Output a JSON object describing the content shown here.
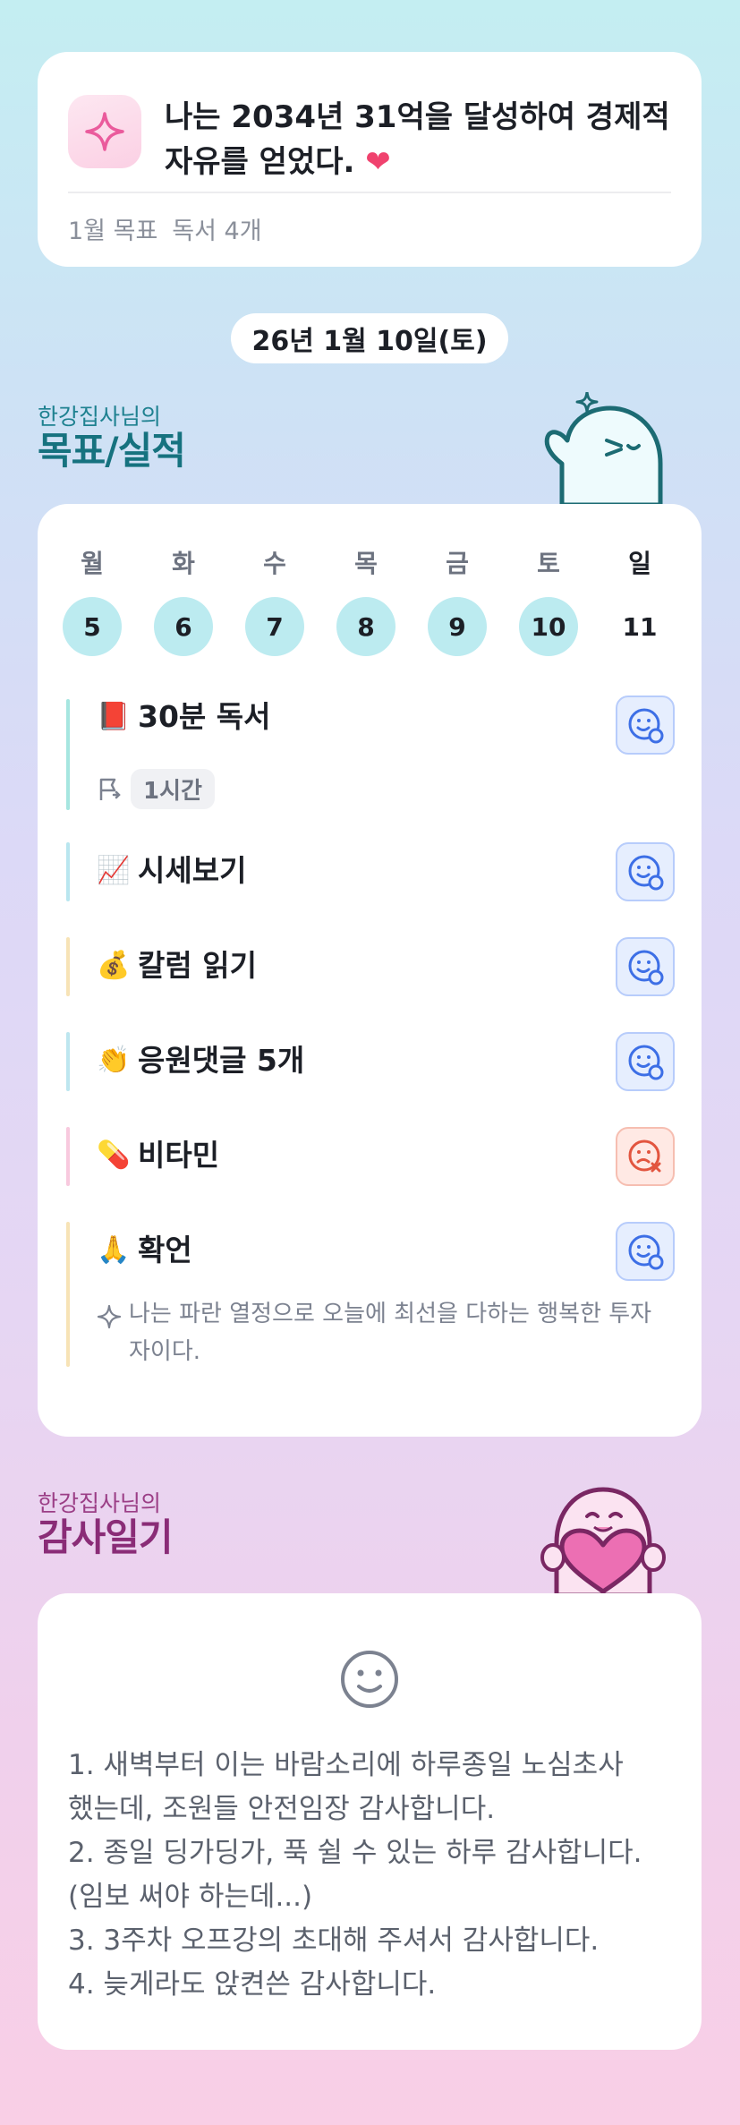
{
  "goal": {
    "text": "나는 2034년 31억을 달성하여 경제적 자유를 얻었다.",
    "heart": "❤",
    "month_label": "1월 목표",
    "month_goal": "독서 4개"
  },
  "date": "26년 1월 10일(토)",
  "performance": {
    "owner": "한강집사님의",
    "title": "목표/실적",
    "week": [
      {
        "day": "월",
        "date": "5",
        "today": false
      },
      {
        "day": "화",
        "date": "6",
        "today": false
      },
      {
        "day": "수",
        "date": "7",
        "today": false
      },
      {
        "day": "목",
        "date": "8",
        "today": false
      },
      {
        "day": "금",
        "date": "9",
        "today": false
      },
      {
        "day": "토",
        "date": "10",
        "today": false
      },
      {
        "day": "일",
        "date": "11",
        "today": true
      }
    ],
    "tasks": [
      {
        "emoji": "📕",
        "label": "30분 독서",
        "status": "done",
        "bar_color": "#a6e6e0",
        "duration": "1시간"
      },
      {
        "emoji": "📈",
        "label": "시세보기",
        "status": "done",
        "bar_color": "#b9e6ef"
      },
      {
        "emoji": "💰",
        "label": "칼럼 읽기",
        "status": "done",
        "bar_color": "#f7e3b6"
      },
      {
        "emoji": "👏",
        "label": "응원댓글 5개",
        "status": "done",
        "bar_color": "#bde6ef"
      },
      {
        "emoji": "💊",
        "label": "비타민",
        "status": "failed",
        "bar_color": "#f8c9de"
      },
      {
        "emoji": "🙏",
        "label": "확언",
        "status": "done",
        "bar_color": "#f7e3b6",
        "note": "나는 파란 열정으로 오늘에 최선을 다하는 행복한 투자자이다."
      }
    ]
  },
  "thanks": {
    "owner": "한강집사님의",
    "title": "감사일기",
    "lines": [
      "1. 새벽부터 이는 바람소리에 하루종일 노심초사",
      "했는데, 조원들 안전임장 감사합니다.",
      "2. 종일 딩가딩가, 푹 쉴 수 있는 하루 감사합니다.",
      "(임보 써야 하는데...)",
      "3. 3주차 오프강의 초대해 주셔서 감사합니다.",
      "4. 늦게라도 앉켠쓴 감사합니다."
    ]
  },
  "colors": {
    "accent_teal": "#16727f",
    "accent_plum": "#8a2c77",
    "status_ok": "#3d6fe6",
    "status_fail": "#e2553f",
    "day_bubble": "#bcebf0"
  },
  "icons": {
    "goal": "sparkle-icon",
    "duration": "flag-icon",
    "status_ok": "smile-check-icon",
    "status_fail": "sad-x-icon",
    "note": "sparkle-outline-icon",
    "thanks": "smiley-icon"
  }
}
